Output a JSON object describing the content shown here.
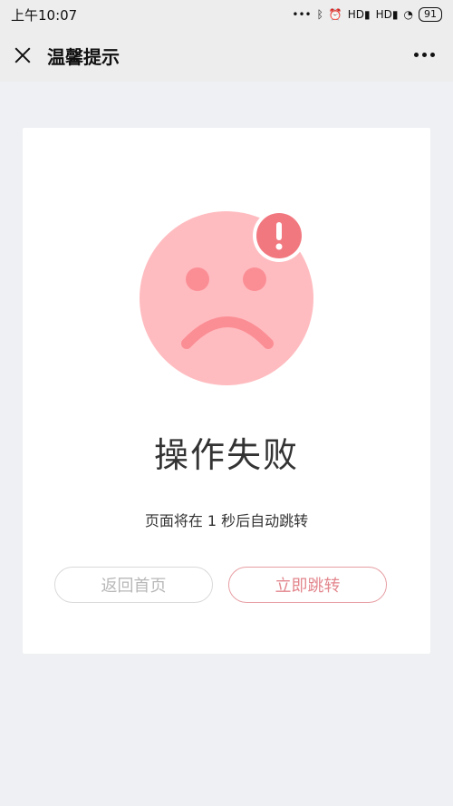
{
  "statusbar": {
    "time": "上午10:07",
    "network1": "HD",
    "network2": "HD",
    "battery": "91"
  },
  "navbar": {
    "title": "温馨提示"
  },
  "result": {
    "title": "操作失败",
    "subtitle": "页面将在 1 秒后自动跳转",
    "home_button": "返回首页",
    "jump_button": "立即跳转"
  },
  "colors": {
    "face": "#ffbcc0",
    "face_features": "#fb8e95",
    "alert_badge": "#f27880"
  }
}
